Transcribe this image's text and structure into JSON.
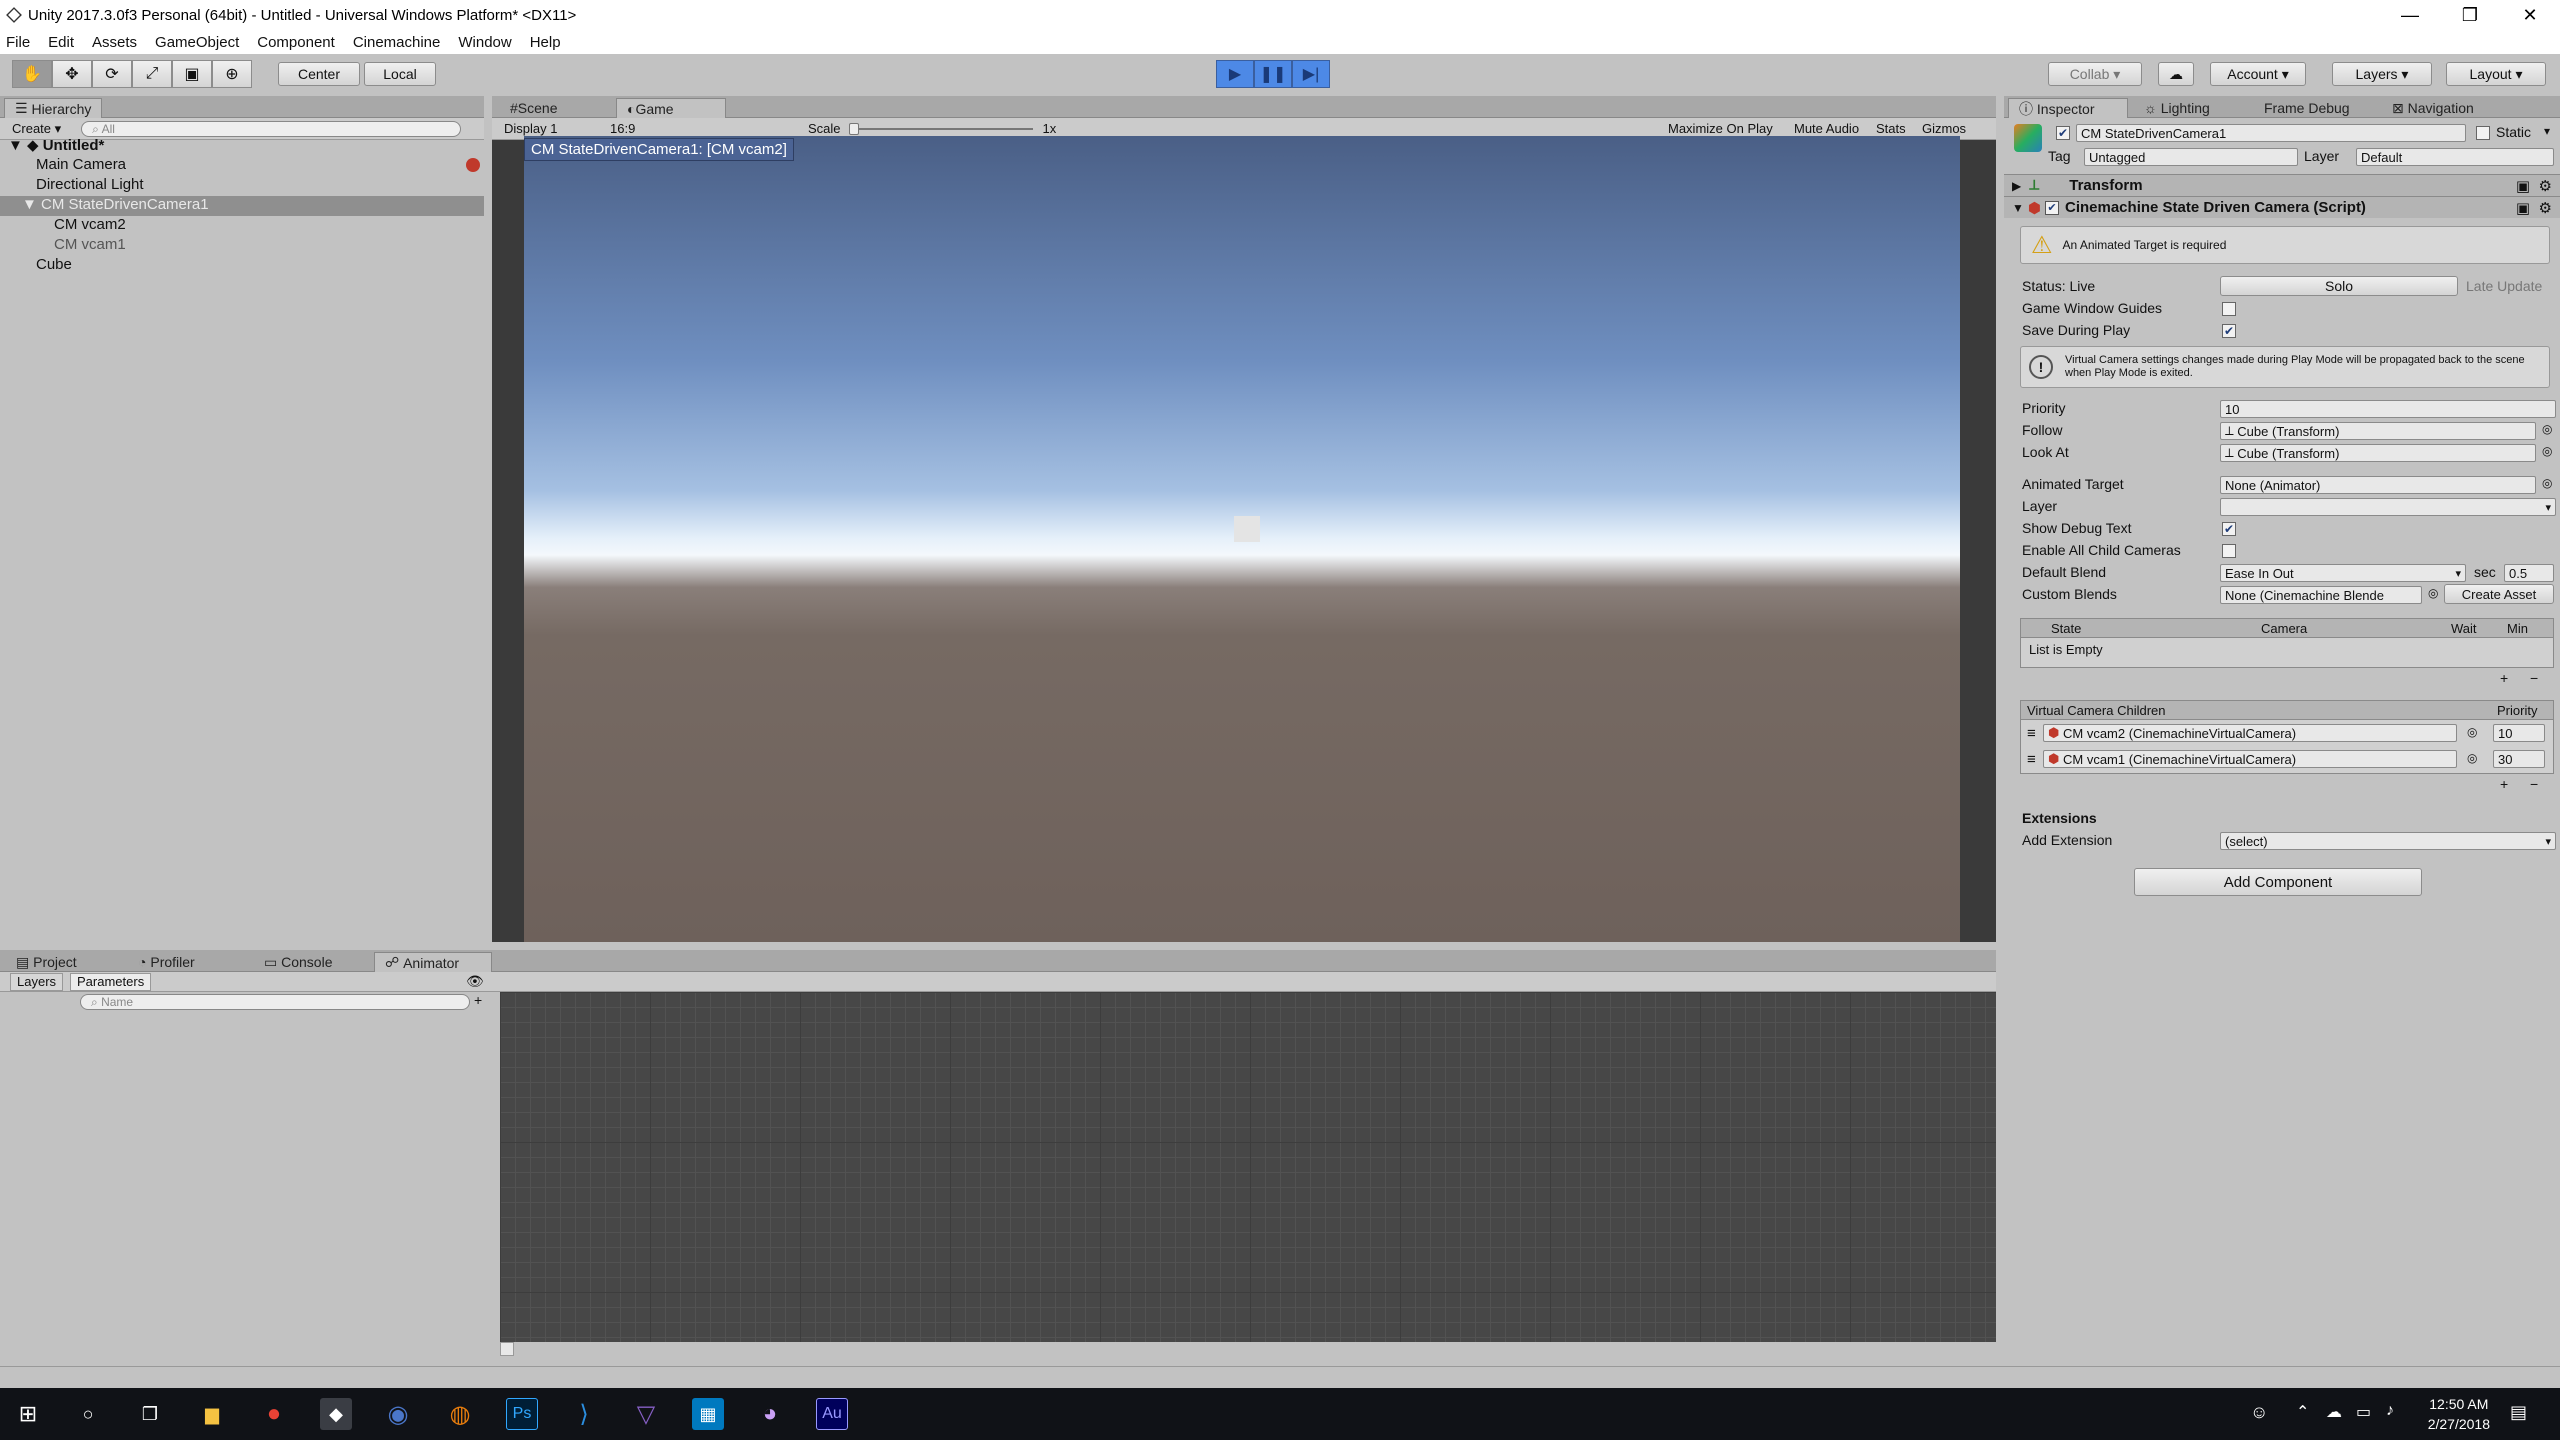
{
  "window": {
    "title": "Unity 2017.3.0f3 Personal (64bit) - Untitled - Universal Windows Platform* <DX11>",
    "minimize": "—",
    "maximize": "❐",
    "close": "✕"
  },
  "menu": [
    "File",
    "Edit",
    "Assets",
    "GameObject",
    "Component",
    "Cinemachine",
    "Window",
    "Help"
  ],
  "toolbar": {
    "pivot_mode": "Center",
    "pivot_rotation": "Local",
    "collab": "Collab ▾",
    "account": "Account",
    "layers": "Layers",
    "layout": "Layout"
  },
  "hierarchy": {
    "tab": "Hierarchy",
    "create": "Create ▾",
    "search_placeholder": "All",
    "scene": "Untitled*",
    "items": [
      "Main Camera",
      "Directional Light",
      "CM StateDrivenCamera1",
      "CM vcam2",
      "CM vcam1",
      "Cube"
    ]
  },
  "game_view": {
    "tabs": [
      "Scene",
      "Game"
    ],
    "display": "Display 1",
    "aspect": "16:9",
    "scale_label": "Scale",
    "scale_value": "1x",
    "maximize_on_play": "Maximize On Play",
    "mute_audio": "Mute Audio",
    "stats": "Stats",
    "gizmos": "Gizmos",
    "camera_label": "CM StateDrivenCamera1: [CM vcam2]"
  },
  "inspector": {
    "tabs": [
      "Inspector",
      "Lighting",
      "Frame Debug",
      "Navigation"
    ],
    "object_name": "CM StateDrivenCamera1",
    "static": "Static",
    "tag_label": "Tag",
    "tag_value": "Untagged",
    "layer_label": "Layer",
    "layer_value": "Default",
    "transform": "Transform",
    "component": "Cinemachine State Driven Camera (Script)",
    "warning": "An Animated Target is required",
    "status_label": "Status: Live",
    "solo": "Solo",
    "late_update": "Late Update",
    "game_window_guides": "Game Window Guides",
    "save_during_play": "Save During Play",
    "info": "Virtual Camera settings changes made during Play Mode will be propagated back to the scene when Play Mode is exited.",
    "priority_label": "Priority",
    "priority_value": "10",
    "follow_label": "Follow",
    "follow_value": "Cube (Transform)",
    "lookat_label": "Look At",
    "lookat_value": "Cube (Transform)",
    "animated_target_label": "Animated Target",
    "animated_target_value": "None (Animator)",
    "layer2_label": "Layer",
    "show_debug_text": "Show Debug Text",
    "enable_all_child": "Enable All Child Cameras",
    "default_blend_label": "Default Blend",
    "default_blend_value": "Ease In Out",
    "sec_label": "sec",
    "sec_value": "0.5",
    "custom_blends_label": "Custom Blends",
    "custom_blends_value": "None (Cinemachine Blende",
    "create_asset": "Create Asset",
    "states_header": [
      "State",
      "Camera",
      "Wait",
      "Min"
    ],
    "list_empty": "List is Empty",
    "children_header": "Virtual Camera Children",
    "children_priority": "Priority",
    "children": [
      {
        "name": "CM vcam2 (CinemachineVirtualCamera)",
        "priority": "10"
      },
      {
        "name": "CM vcam1 (CinemachineVirtualCamera)",
        "priority": "30"
      }
    ],
    "extensions": "Extensions",
    "add_extension_label": "Add Extension",
    "add_extension_value": "(select)",
    "add_component": "Add Component"
  },
  "bottom": {
    "tabs": [
      "Project",
      "Profiler",
      "Console",
      "Animator"
    ],
    "subtabs": [
      "Layers",
      "Parameters"
    ],
    "search_placeholder": "Name"
  },
  "taskbar": {
    "time": "12:50 AM",
    "date": "2/27/2018",
    "apps": [
      "start-icon",
      "search-icon",
      "task-view-icon",
      "file-explorer-icon",
      "chrome-icon",
      "unity-icon",
      "cinema4d-icon",
      "blender-icon",
      "photoshop-icon",
      "vscode-icon",
      "visual-studio-icon",
      "trello-icon",
      "github-icon",
      "audition-icon"
    ],
    "app_labels": [
      "⊞",
      "○",
      "❐",
      "▆",
      "●",
      "◆",
      "◉",
      "◍",
      "Ps",
      "⟩",
      "▽",
      "▦",
      "◕",
      "Au"
    ]
  },
  "colors": {
    "play_active": "#4d89e6",
    "selection": "#8f8f8f",
    "taskbar": "#101217"
  }
}
